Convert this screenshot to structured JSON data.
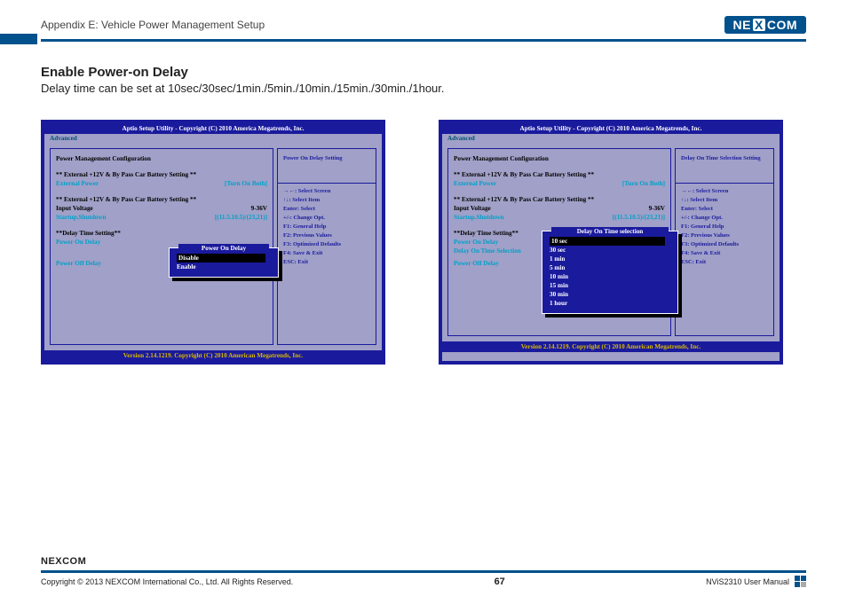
{
  "header": {
    "appendix": "Appendix E: Vehicle Power Management Setup",
    "brand": {
      "pre": "NE",
      "x": "X",
      "post": "COM"
    }
  },
  "section": {
    "title": "Enable Power-on Delay",
    "desc": "Delay time can be set at 10sec/30sec/1min./5min./10min./15min./30min./1hour."
  },
  "bios": {
    "title": "Aptio Setup Utility - Copyright (C) 2010 America Megatrends, Inc.",
    "tab": "Advanced",
    "cfg_header": "Power Management Configuration",
    "battery_header": "** External +12V & By Pass Car Battery Setting **",
    "ext_power_lbl": "External Power",
    "ext_power_val": "[Turn On Both]",
    "voltage_header": "** External +12V & By Pass Car Battery Setting **",
    "in_voltage_lbl": "Input Voltage",
    "in_voltage_val": "9-36V",
    "startup_lbl": "Startup.Shutdown",
    "startup_val": "[(11.5.10.5)/(23,21)]",
    "delay_header": "**Delay Time Setting**",
    "pon_delay_lbl": "Power On Delay",
    "poff_delay_lbl": "Power Off Delay",
    "delay_on_sel_lbl": "Delay On Time Selection",
    "help_keys": [
      "→←: Select Screen",
      "↑↓: Select Item",
      "Enter: Select",
      "+/-: Change Opt.",
      "F1: General Help",
      "F2: Previous Values",
      "F3: Optimized Defaults",
      "F4: Save & Exit",
      "ESC: Exit"
    ],
    "footer": "Version 2.14.1219. Copyright (C) 2010 American Megatrends, Inc."
  },
  "left_pane": {
    "help_title": "Power On Delay Setting",
    "popup_title": "Power On Delay",
    "opts": [
      "Disable",
      "Enable"
    ]
  },
  "right_pane": {
    "help_title": "Delay On Time Selection Setting",
    "popup_title": "Delay On Time selection",
    "opts": [
      "10 sec",
      "30 sec",
      "1 min",
      "5 min",
      "10 min",
      "15 min",
      "30 min",
      "1 hour"
    ]
  },
  "footer": {
    "copyright": "Copyright © 2013 NEXCOM International Co., Ltd. All Rights Reserved.",
    "page": "67",
    "doc": "NViS2310 User Manual",
    "logo_text": "NEXCOM"
  },
  "chart_data": null
}
